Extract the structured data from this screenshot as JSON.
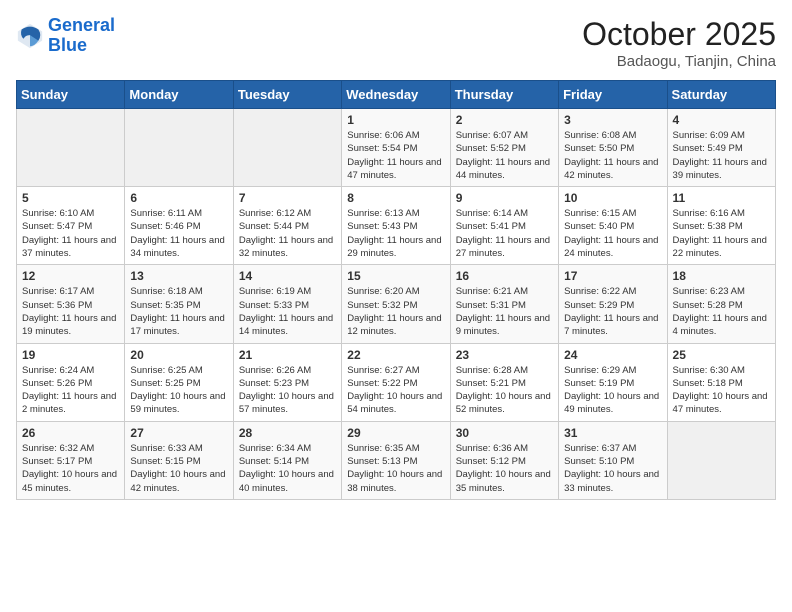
{
  "header": {
    "logo_line1": "General",
    "logo_line2": "Blue",
    "month": "October 2025",
    "location": "Badaogu, Tianjin, China"
  },
  "days_of_week": [
    "Sunday",
    "Monday",
    "Tuesday",
    "Wednesday",
    "Thursday",
    "Friday",
    "Saturday"
  ],
  "weeks": [
    [
      {
        "day": "",
        "info": ""
      },
      {
        "day": "",
        "info": ""
      },
      {
        "day": "",
        "info": ""
      },
      {
        "day": "1",
        "info": "Sunrise: 6:06 AM\nSunset: 5:54 PM\nDaylight: 11 hours and 47 minutes."
      },
      {
        "day": "2",
        "info": "Sunrise: 6:07 AM\nSunset: 5:52 PM\nDaylight: 11 hours and 44 minutes."
      },
      {
        "day": "3",
        "info": "Sunrise: 6:08 AM\nSunset: 5:50 PM\nDaylight: 11 hours and 42 minutes."
      },
      {
        "day": "4",
        "info": "Sunrise: 6:09 AM\nSunset: 5:49 PM\nDaylight: 11 hours and 39 minutes."
      }
    ],
    [
      {
        "day": "5",
        "info": "Sunrise: 6:10 AM\nSunset: 5:47 PM\nDaylight: 11 hours and 37 minutes."
      },
      {
        "day": "6",
        "info": "Sunrise: 6:11 AM\nSunset: 5:46 PM\nDaylight: 11 hours and 34 minutes."
      },
      {
        "day": "7",
        "info": "Sunrise: 6:12 AM\nSunset: 5:44 PM\nDaylight: 11 hours and 32 minutes."
      },
      {
        "day": "8",
        "info": "Sunrise: 6:13 AM\nSunset: 5:43 PM\nDaylight: 11 hours and 29 minutes."
      },
      {
        "day": "9",
        "info": "Sunrise: 6:14 AM\nSunset: 5:41 PM\nDaylight: 11 hours and 27 minutes."
      },
      {
        "day": "10",
        "info": "Sunrise: 6:15 AM\nSunset: 5:40 PM\nDaylight: 11 hours and 24 minutes."
      },
      {
        "day": "11",
        "info": "Sunrise: 6:16 AM\nSunset: 5:38 PM\nDaylight: 11 hours and 22 minutes."
      }
    ],
    [
      {
        "day": "12",
        "info": "Sunrise: 6:17 AM\nSunset: 5:36 PM\nDaylight: 11 hours and 19 minutes."
      },
      {
        "day": "13",
        "info": "Sunrise: 6:18 AM\nSunset: 5:35 PM\nDaylight: 11 hours and 17 minutes."
      },
      {
        "day": "14",
        "info": "Sunrise: 6:19 AM\nSunset: 5:33 PM\nDaylight: 11 hours and 14 minutes."
      },
      {
        "day": "15",
        "info": "Sunrise: 6:20 AM\nSunset: 5:32 PM\nDaylight: 11 hours and 12 minutes."
      },
      {
        "day": "16",
        "info": "Sunrise: 6:21 AM\nSunset: 5:31 PM\nDaylight: 11 hours and 9 minutes."
      },
      {
        "day": "17",
        "info": "Sunrise: 6:22 AM\nSunset: 5:29 PM\nDaylight: 11 hours and 7 minutes."
      },
      {
        "day": "18",
        "info": "Sunrise: 6:23 AM\nSunset: 5:28 PM\nDaylight: 11 hours and 4 minutes."
      }
    ],
    [
      {
        "day": "19",
        "info": "Sunrise: 6:24 AM\nSunset: 5:26 PM\nDaylight: 11 hours and 2 minutes."
      },
      {
        "day": "20",
        "info": "Sunrise: 6:25 AM\nSunset: 5:25 PM\nDaylight: 10 hours and 59 minutes."
      },
      {
        "day": "21",
        "info": "Sunrise: 6:26 AM\nSunset: 5:23 PM\nDaylight: 10 hours and 57 minutes."
      },
      {
        "day": "22",
        "info": "Sunrise: 6:27 AM\nSunset: 5:22 PM\nDaylight: 10 hours and 54 minutes."
      },
      {
        "day": "23",
        "info": "Sunrise: 6:28 AM\nSunset: 5:21 PM\nDaylight: 10 hours and 52 minutes."
      },
      {
        "day": "24",
        "info": "Sunrise: 6:29 AM\nSunset: 5:19 PM\nDaylight: 10 hours and 49 minutes."
      },
      {
        "day": "25",
        "info": "Sunrise: 6:30 AM\nSunset: 5:18 PM\nDaylight: 10 hours and 47 minutes."
      }
    ],
    [
      {
        "day": "26",
        "info": "Sunrise: 6:32 AM\nSunset: 5:17 PM\nDaylight: 10 hours and 45 minutes."
      },
      {
        "day": "27",
        "info": "Sunrise: 6:33 AM\nSunset: 5:15 PM\nDaylight: 10 hours and 42 minutes."
      },
      {
        "day": "28",
        "info": "Sunrise: 6:34 AM\nSunset: 5:14 PM\nDaylight: 10 hours and 40 minutes."
      },
      {
        "day": "29",
        "info": "Sunrise: 6:35 AM\nSunset: 5:13 PM\nDaylight: 10 hours and 38 minutes."
      },
      {
        "day": "30",
        "info": "Sunrise: 6:36 AM\nSunset: 5:12 PM\nDaylight: 10 hours and 35 minutes."
      },
      {
        "day": "31",
        "info": "Sunrise: 6:37 AM\nSunset: 5:10 PM\nDaylight: 10 hours and 33 minutes."
      },
      {
        "day": "",
        "info": ""
      }
    ]
  ]
}
